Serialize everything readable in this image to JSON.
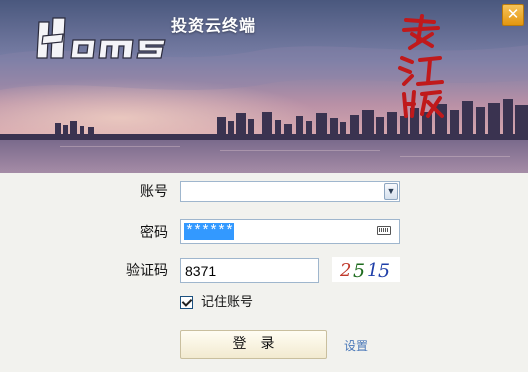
{
  "app": {
    "logo_text": "Homs",
    "subtitle": "投资云终端",
    "seal_text": "残江版"
  },
  "form": {
    "account_label": "账号",
    "account_value": "",
    "password_label": "密码",
    "password_value": "******",
    "captcha_label": "验证码",
    "captcha_value": "8371",
    "captcha_image_text": "2515",
    "remember_label": "记住账号",
    "remember_checked": true
  },
  "buttons": {
    "login_label": "登录",
    "settings_label": "设置",
    "close_label": "✕"
  },
  "colors": {
    "accent_blue": "#3399ff",
    "link_blue": "#4a78b8",
    "close_orange": "#e4960f",
    "seal_red": "#c0191b"
  }
}
